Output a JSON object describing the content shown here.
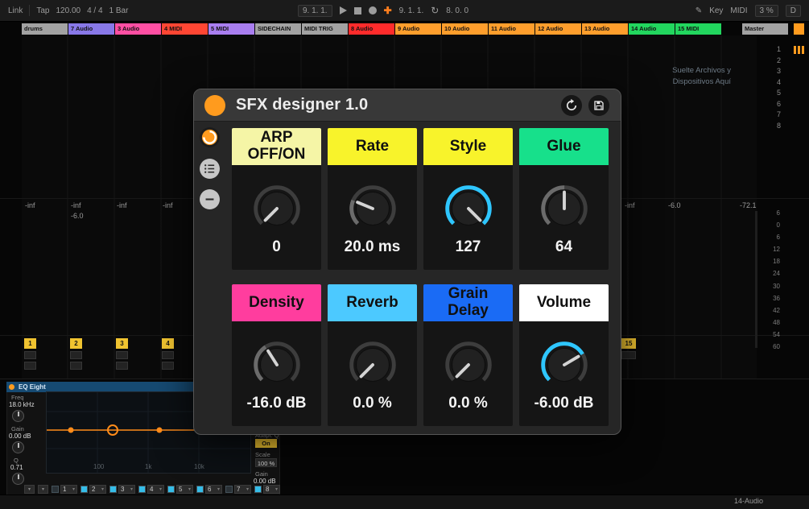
{
  "transport": {
    "link": "Link",
    "tap": "Tap",
    "tempo": "120.00",
    "time_sig": "4 / 4",
    "quantize": "1 Bar",
    "position": "9. 1. 1.",
    "loop_start": "9. 1. 1.",
    "loop_length": "8. 0. 0",
    "key": "Key",
    "midi": "MIDI",
    "cpu": "3 %",
    "crossfade": "D"
  },
  "tracks": [
    {
      "name": "drums",
      "color": "#a2a2a2"
    },
    {
      "name": "7 Audio",
      "color": "#8878e8"
    },
    {
      "name": "3 Audio",
      "color": "#ff4fa3"
    },
    {
      "name": "4 MIDI",
      "color": "#ff4633"
    },
    {
      "name": "5 MIDI",
      "color": "#a97ef0"
    },
    {
      "name": "SIDECHAIN",
      "color": "#a2a2a2"
    },
    {
      "name": "MIDI TRIG",
      "color": "#a2a2a2"
    },
    {
      "name": "8 Audio",
      "color": "#ff2b2b"
    },
    {
      "name": "9 Audio",
      "color": "#ff9e2c"
    },
    {
      "name": "10 Audio",
      "color": "#ff9e2c"
    },
    {
      "name": "11 Audio",
      "color": "#ff9e2c"
    },
    {
      "name": "12 Audio",
      "color": "#ff9e2c"
    },
    {
      "name": "13 Audio",
      "color": "#ff9e2c"
    },
    {
      "name": "14 Audio",
      "color": "#22d65e"
    },
    {
      "name": "15 MIDI",
      "color": "#22d65e"
    }
  ],
  "master": {
    "name": "Master",
    "color": "#a2a2a2"
  },
  "scenes": [
    "1",
    "2",
    "3",
    "4",
    "5",
    "6",
    "7",
    "8"
  ],
  "drop_hint": {
    "line1": "Suelte Archivos y",
    "line2": "Dispositivos Aquí"
  },
  "levels": {
    "inf1": "-inf",
    "inf2": "-inf",
    "inf3": "-inf",
    "inf4": "-inf",
    "db_left": "-6.0",
    "inf_right": "-inf",
    "db_right": "-6.0",
    "master_db": "-72.1"
  },
  "meter_scale": [
    "6",
    "0",
    "6",
    "12",
    "18",
    "24",
    "30",
    "36",
    "42",
    "48",
    "54",
    "60"
  ],
  "activators": {
    "a1": "1",
    "a2": "2",
    "a3": "3",
    "a4": "4",
    "right": "15"
  },
  "eq": {
    "title": "EQ Eight",
    "freq_label": "Freq",
    "freq_value": "18.0 kHz",
    "gain_label": "Gain",
    "gain_value": "0.00 dB",
    "q_label": "Q",
    "q_value": "0.71",
    "adapt_label": "Adapt. Q",
    "adapt_value": "On",
    "scale_label": "Scale",
    "scale_value": "100 %",
    "gain2_label": "Gain",
    "gain2_value": "0.00 dB",
    "freq_ticks": [
      "100",
      "1k",
      "10k"
    ],
    "bands": [
      "1",
      "2",
      "3",
      "4",
      "5",
      "6",
      "7",
      "8"
    ],
    "band_colors": [
      "#2a3136",
      "#35bde8",
      "#35bde8",
      "#35bde8",
      "#35bde8",
      "#35bde8",
      "#2a3136",
      "#35bde8"
    ]
  },
  "statusbar": {
    "track": "14-Audio"
  },
  "device": {
    "title": "SFX designer 1.0",
    "accent": "#ff9b1e",
    "cells": [
      {
        "label": "ARP OFF/ON",
        "header_bg": "#f5f5a6",
        "value": "0",
        "fraction": 0,
        "arc_color": "#6b6b6b"
      },
      {
        "label": "Rate",
        "header_bg": "#f8f32b",
        "value": "20.0 ms",
        "fraction": 0.25,
        "arc_color": "#6b6b6b"
      },
      {
        "label": "Style",
        "header_bg": "#f8f32b",
        "value": "127",
        "fraction": 1,
        "arc_color": "#2ec6ff"
      },
      {
        "label": "Glue",
        "header_bg": "#17e08b",
        "value": "64",
        "fraction": 0.5,
        "arc_color": "#6b6b6b"
      },
      {
        "label": "Density",
        "header_bg": "#ff3d9e",
        "value": "-16.0 dB",
        "fraction": 0.38,
        "arc_color": "#6b6b6b"
      },
      {
        "label": "Reverb",
        "header_bg": "#4cc9ff",
        "value": "0.0 %",
        "fraction": 0,
        "arc_color": "#6b6b6b"
      },
      {
        "label": "Grain Delay",
        "header_bg": "#1a6bf5",
        "value": "0.0 %",
        "fraction": 0,
        "arc_color": "#6b6b6b"
      },
      {
        "label": "Volume",
        "header_bg": "#ffffff",
        "value": "-6.00 dB",
        "fraction": 0.72,
        "arc_color": "#2ec6ff"
      }
    ]
  }
}
